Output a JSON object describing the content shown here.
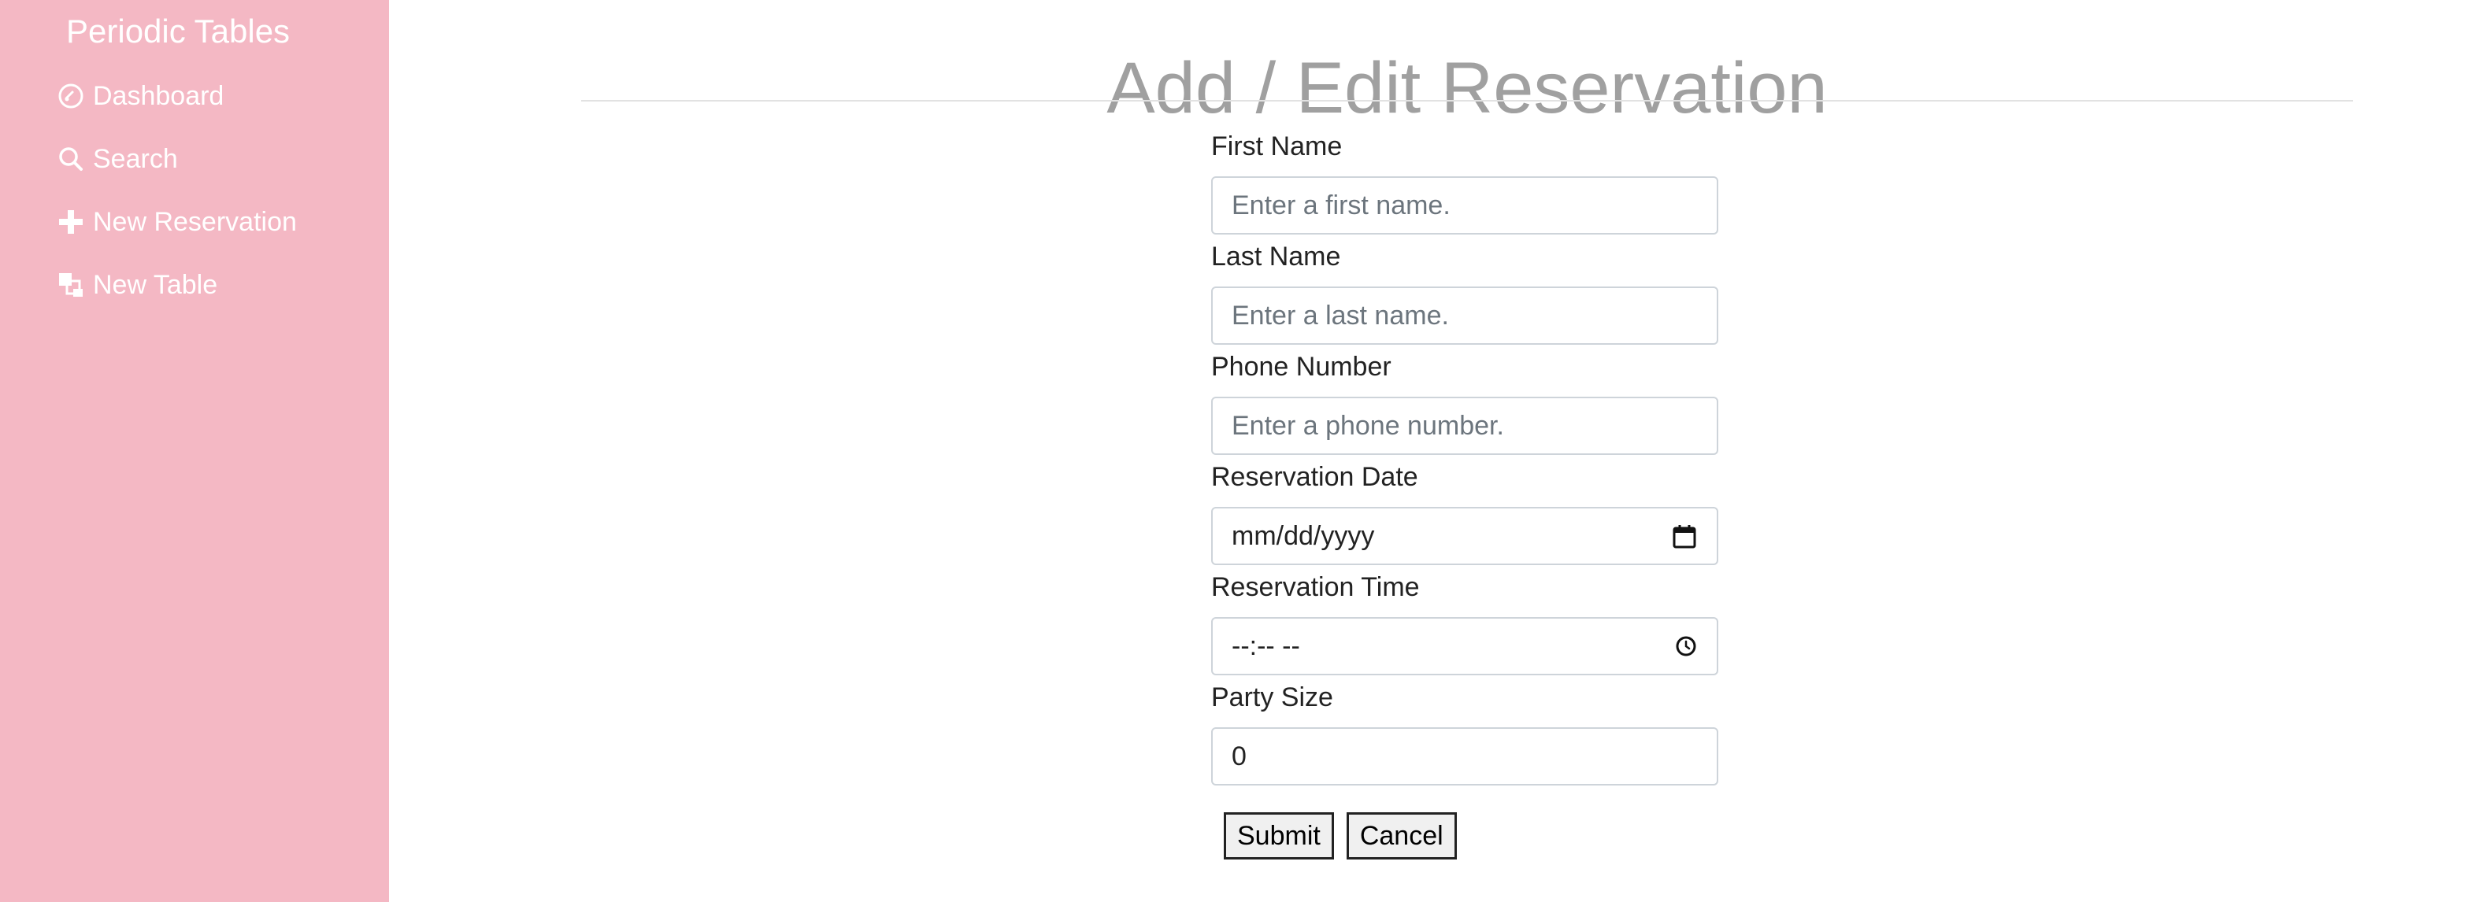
{
  "sidebar": {
    "brand": "Periodic Tables",
    "items": [
      {
        "label": "Dashboard",
        "icon": "dashboard-icon"
      },
      {
        "label": "Search",
        "icon": "search-icon"
      },
      {
        "label": "New Reservation",
        "icon": "plus-icon"
      },
      {
        "label": "New Table",
        "icon": "table-icon"
      }
    ],
    "background": "#f4b8c4"
  },
  "main": {
    "title": "Add / Edit Reservation",
    "form": {
      "first_name": {
        "label": "First Name",
        "placeholder": "Enter a first name."
      },
      "last_name": {
        "label": "Last Name",
        "placeholder": "Enter a last name."
      },
      "phone": {
        "label": "Phone Number",
        "placeholder": "Enter a phone number."
      },
      "date": {
        "label": "Reservation Date",
        "value": "mm/dd/yyyy",
        "icon": "calendar-icon"
      },
      "time": {
        "label": "Reservation Time",
        "value": "--:-- --",
        "icon": "clock-icon"
      },
      "party_size": {
        "label": "Party Size",
        "value": "0"
      }
    },
    "buttons": {
      "submit": "Submit",
      "cancel": "Cancel"
    }
  }
}
